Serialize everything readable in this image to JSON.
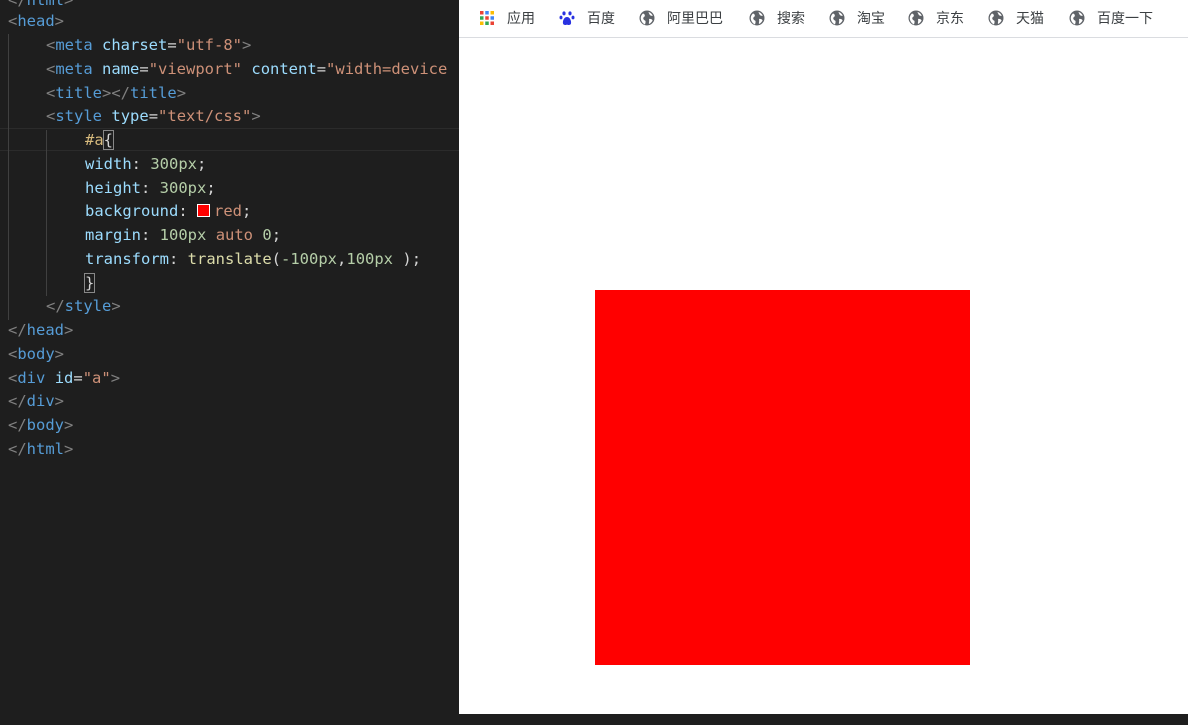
{
  "editor": {
    "lines": {
      "l0": {
        "open": "</",
        "tag": "html",
        "close": ">"
      },
      "l1": {
        "open": "<",
        "tag": "head",
        "close": ">"
      },
      "l2": {
        "open": "<",
        "tag": "meta",
        "attr1": "charset",
        "eq": "=",
        "val1": "\"utf-8\"",
        "close": ">"
      },
      "l3": {
        "open": "<",
        "tag": "meta",
        "attr1": "name",
        "eq": "=",
        "val1": "\"viewport\"",
        "attr2": "content",
        "val2": "\"width=device"
      },
      "l4": {
        "open": "<",
        "tag": "title",
        "mid": "></",
        "tag2": "title",
        "close": ">"
      },
      "l5": {
        "open": "<",
        "tag": "style",
        "attr1": "type",
        "eq": "=",
        "val1": "\"text/css\"",
        "close": ">"
      },
      "l6": {
        "selector": "#a",
        "brace": "{"
      },
      "l7": {
        "prop": "width",
        "colon": ": ",
        "value": "300px",
        "semi": ";"
      },
      "l8": {
        "prop": "height",
        "colon": ": ",
        "value": "300px",
        "semi": ";"
      },
      "l9": {
        "prop": "background",
        "colon": ": ",
        "value": "red",
        "semi": ";"
      },
      "l10": {
        "prop": "margin",
        "colon": ": ",
        "v1": "100px",
        "v2": "auto",
        "v3": "0",
        "semi": ";"
      },
      "l11": {
        "prop": "transform",
        "colon": ": ",
        "func": "translate",
        "args1": "(",
        "n1": "-100px",
        "comma": ",",
        "n2": "100px",
        "args2": " );"
      },
      "l12": {
        "brace": "}"
      },
      "l13": {
        "open": "</",
        "tag": "style",
        "close": ">"
      },
      "l14": {
        "open": "</",
        "tag": "head",
        "close": ">"
      },
      "l15": {
        "open": "<",
        "tag": "body",
        "close": ">"
      },
      "l16": {
        "open": "<",
        "tag": "div",
        "attr1": "id",
        "eq": "=",
        "val1": "\"a\"",
        "close": ">"
      },
      "l17": {
        "open": "</",
        "tag": "div",
        "close": ">"
      },
      "l18": {
        "open": "</",
        "tag": "body",
        "close": ">"
      },
      "l19": {
        "open": "</",
        "tag": "html",
        "close": ">"
      }
    },
    "swatch_color": "#ff0000"
  },
  "browser": {
    "bookmarks": [
      {
        "label": "应用",
        "icon": "apps-grid-icon"
      },
      {
        "label": "百度",
        "icon": "baidu-paw-icon"
      },
      {
        "label": "阿里巴巴",
        "icon": "globe-icon"
      },
      {
        "label": "搜索",
        "icon": "globe-icon"
      },
      {
        "label": "淘宝",
        "icon": "globe-icon"
      },
      {
        "label": "京东",
        "icon": "globe-icon"
      },
      {
        "label": "天猫",
        "icon": "globe-icon"
      },
      {
        "label": "百度一下",
        "icon": "globe-icon"
      }
    ],
    "red_box_color": "#ff0000"
  }
}
